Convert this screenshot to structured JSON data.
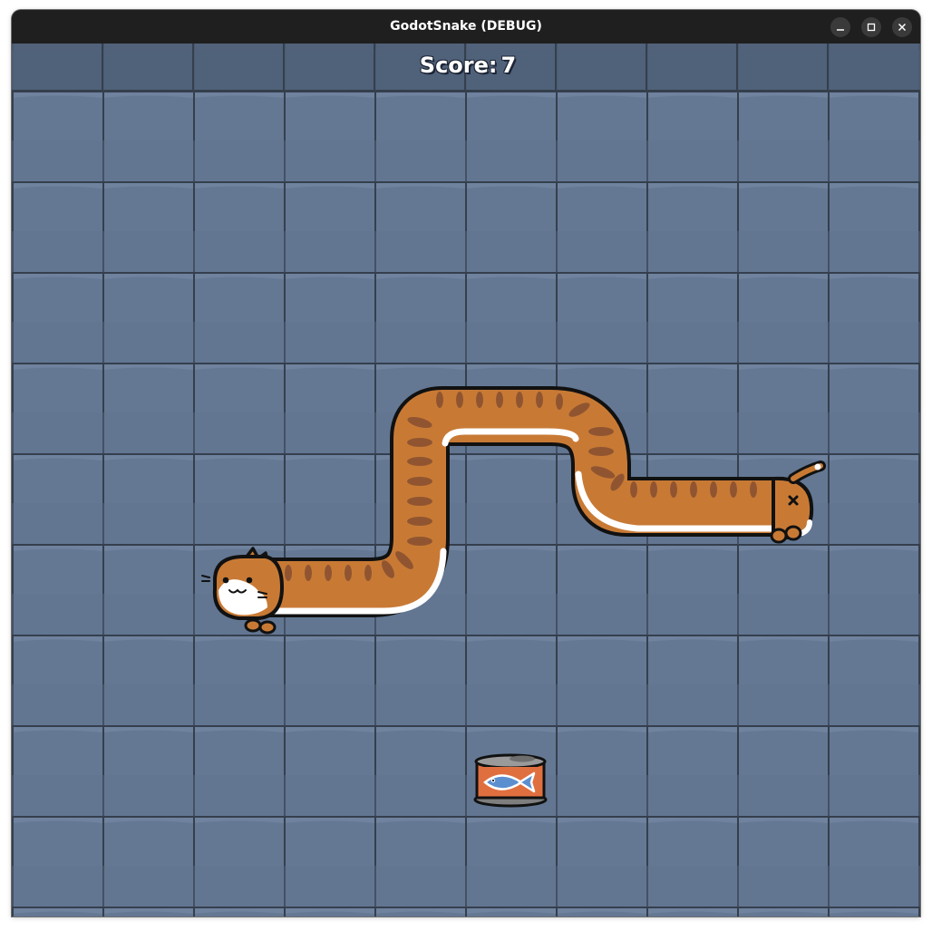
{
  "window": {
    "title": "GodotSnake (DEBUG)",
    "buttons": {
      "minimize_icon": "minimize-icon",
      "maximize_icon": "maximize-icon",
      "close_icon": "close-icon"
    }
  },
  "hud": {
    "score_label": "Score:",
    "score_value": "7"
  },
  "colors": {
    "tile": "#647893",
    "tile_shade": "#5c6f89",
    "grid_line": "#353f4d",
    "top_band": "#4e5e76",
    "cat_fur": "#c87a35",
    "cat_stripe": "#8b5230",
    "cat_belly": "#ffffff",
    "outline": "#111111",
    "can_label": "#e06f3f",
    "can_lid": "#9a9a9a",
    "fish": "#5b8fd0"
  },
  "sprites": {
    "snake_head": "cat-head",
    "snake_body": "cat-body",
    "snake_tail": "cat-tail",
    "food": "fish-can"
  }
}
